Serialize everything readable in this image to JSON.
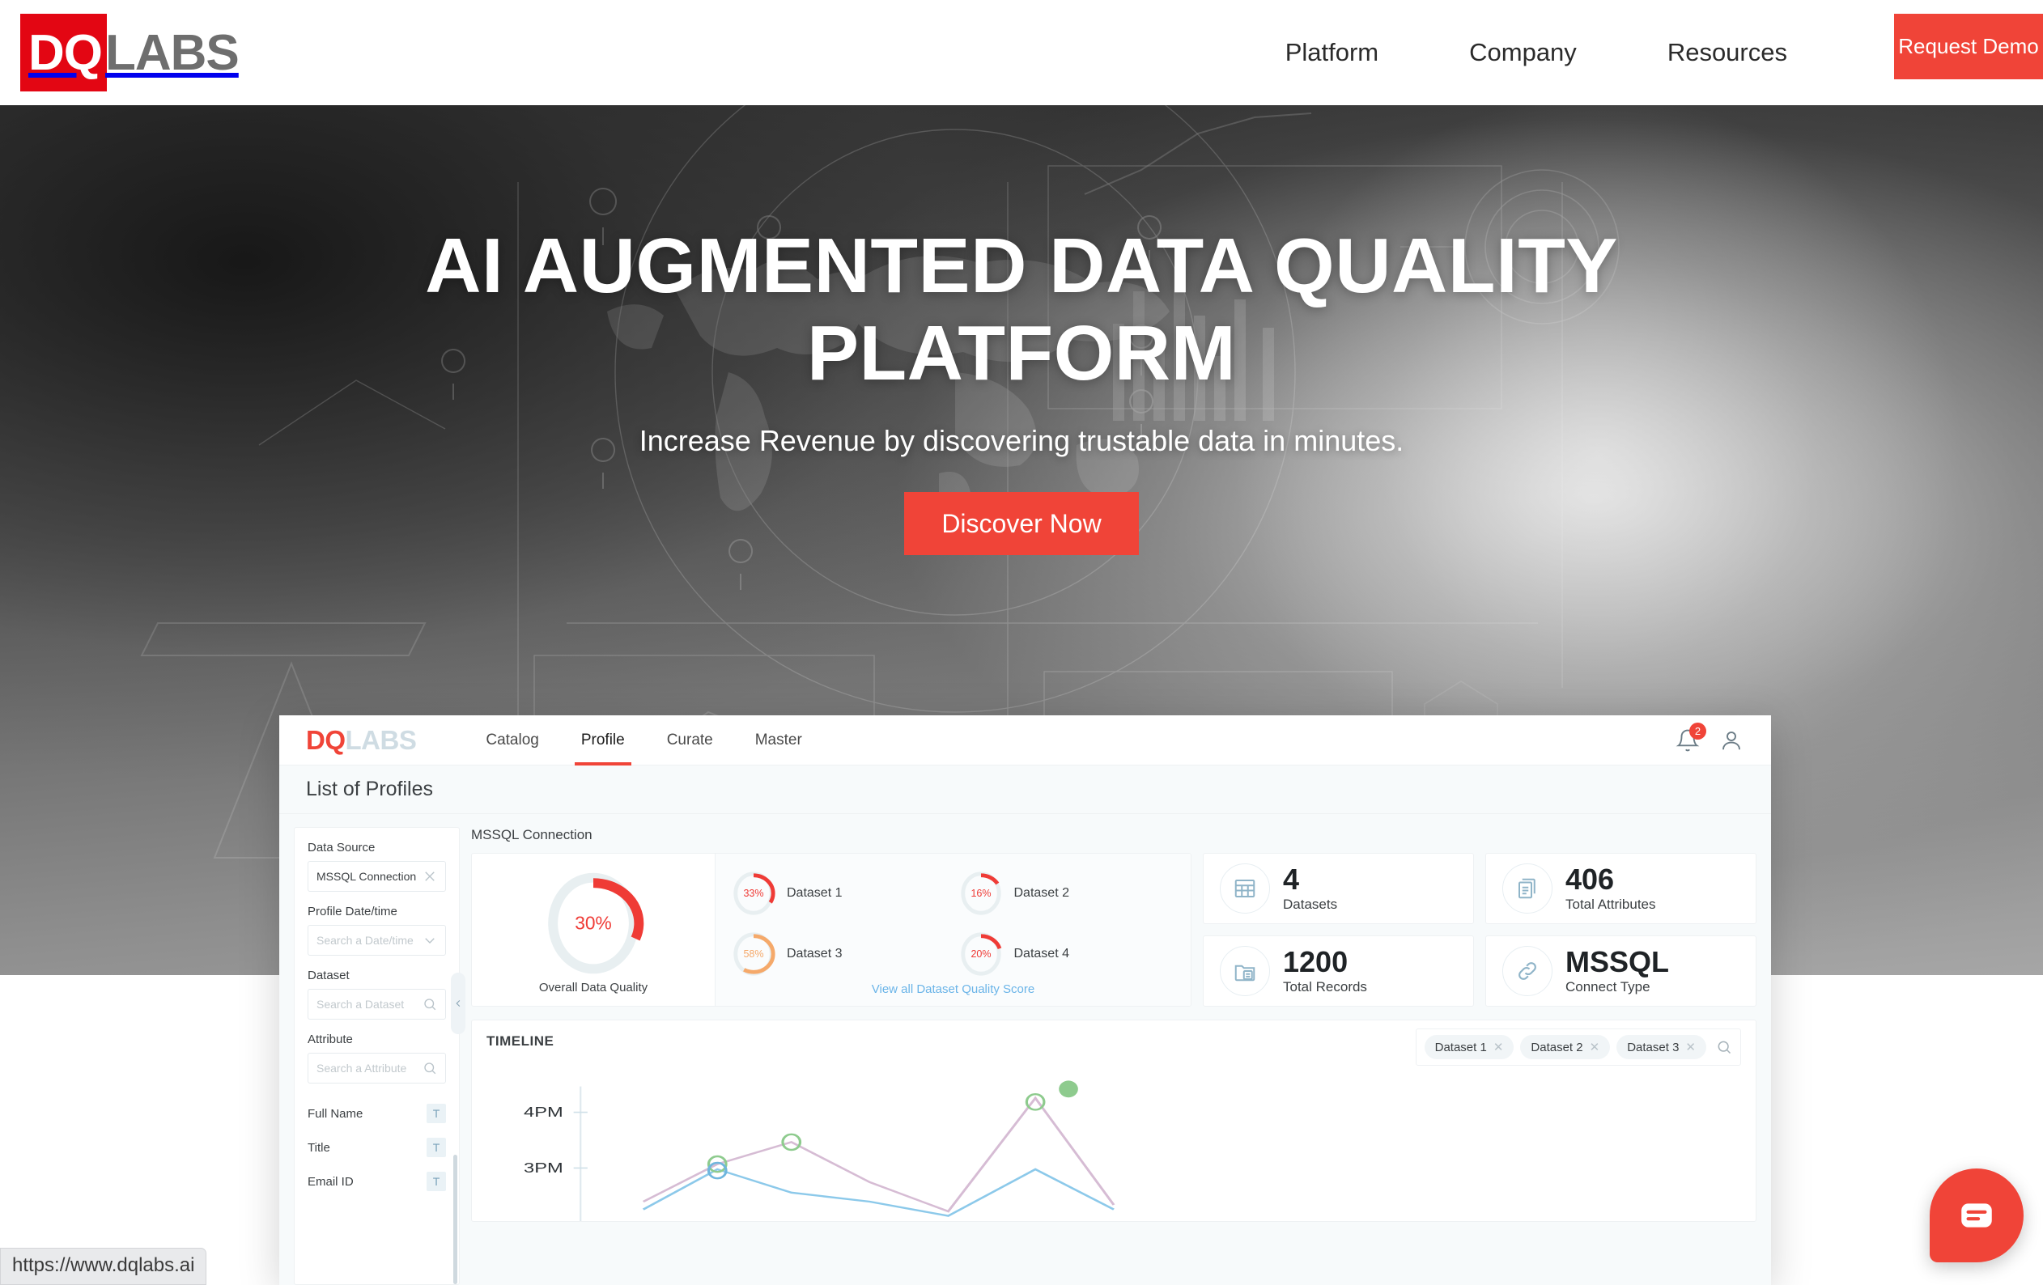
{
  "site": {
    "logo": {
      "mark": "DQ",
      "rest": "LABS"
    },
    "nav": [
      {
        "label": "Platform"
      },
      {
        "label": "Company"
      },
      {
        "label": "Resources"
      }
    ],
    "cta": "Request Demo",
    "accent": "#f04438",
    "brand_red": "#e30613"
  },
  "hero": {
    "title_line1": "AI AUGMENTED DATA QUALITY",
    "title_line2": "PLATFORM",
    "subtitle": "Increase Revenue by discovering trustable data in minutes.",
    "button": "Discover Now"
  },
  "app": {
    "logo": {
      "mark": "DQ",
      "rest": "LABS"
    },
    "tabs": [
      {
        "label": "Catalog",
        "active": false
      },
      {
        "label": "Profile",
        "active": true
      },
      {
        "label": "Curate",
        "active": false
      },
      {
        "label": "Master",
        "active": false
      }
    ],
    "notification_count": "2",
    "page_title": "List of Profiles",
    "sidebar": {
      "fields": [
        {
          "label": "Data Source",
          "value": "MSSQL Connection",
          "placeholder": "",
          "icon": "close-icon"
        },
        {
          "label": "Profile Date/time",
          "value": "",
          "placeholder": "Search a Date/time",
          "icon": "chevron-down-icon"
        },
        {
          "label": "Dataset",
          "value": "",
          "placeholder": "Search a Dataset",
          "icon": "search-icon"
        },
        {
          "label": "Attribute",
          "value": "",
          "placeholder": "Search a Attribute",
          "icon": "search-icon"
        }
      ],
      "attributes": [
        {
          "name": "Full Name",
          "type": "T"
        },
        {
          "name": "Title",
          "type": "T"
        },
        {
          "name": "Email ID",
          "type": "T"
        }
      ]
    },
    "main": {
      "connection_title": "MSSQL Connection",
      "overall": {
        "percent": 30,
        "label_value": "30%",
        "caption": "Overall Data Quality",
        "color": "#ef3b36"
      },
      "datasets": [
        {
          "name": "Dataset 1",
          "label_value": "33%",
          "percent": 33,
          "color": "#ef3b36"
        },
        {
          "name": "Dataset 2",
          "label_value": "16%",
          "percent": 16,
          "color": "#ef3b36"
        },
        {
          "name": "Dataset 3",
          "label_value": "58%",
          "percent": 58,
          "color": "#f5a96a"
        },
        {
          "name": "Dataset 4",
          "label_value": "20%",
          "percent": 20,
          "color": "#ef3b36"
        }
      ],
      "view_all_link": "View all Dataset Quality Score",
      "kpis": [
        {
          "value": "4",
          "caption": "Datasets",
          "icon": "table-grid-icon"
        },
        {
          "value": "406",
          "caption": "Total Attributes",
          "icon": "documents-icon"
        },
        {
          "value": "1200",
          "caption": "Total Records",
          "icon": "records-folder-icon"
        },
        {
          "value": "MSSQL",
          "caption": "Connect Type",
          "icon": "link-icon"
        }
      ],
      "timeline": {
        "title": "TIMELINE",
        "chips": [
          {
            "label": "Dataset 1"
          },
          {
            "label": "Dataset 2"
          },
          {
            "label": "Dataset 3"
          }
        ],
        "y_ticks": [
          "4PM",
          "3PM"
        ]
      }
    }
  },
  "chart_data": {
    "type": "line",
    "title": "TIMELINE",
    "xlabel": "",
    "ylabel": "",
    "y_tick_labels": [
      "3PM",
      "4PM"
    ],
    "series": [
      {
        "name": "Dataset 1",
        "color": "#c9a6c4",
        "x": [
          0,
          1,
          2,
          3,
          4,
          5,
          6
        ],
        "y": [
          1.4,
          2.9,
          3.3,
          2.4,
          1.2,
          4.2,
          2.0
        ]
      },
      {
        "name": "Dataset 2",
        "color": "#7fc6ea",
        "x": [
          0,
          1,
          2,
          3,
          4,
          5,
          6
        ],
        "y": [
          1.1,
          2.9,
          1.9,
          1.5,
          1.0,
          2.4,
          1.4
        ]
      },
      {
        "name": "Dataset 3",
        "color": "#8ecb8e",
        "x": [
          0,
          1,
          2,
          3,
          4,
          5,
          6
        ],
        "y": [
          1.3,
          3.0,
          3.3,
          2.2,
          1.3,
          4.3,
          2.1
        ]
      }
    ],
    "legend": [
      "Dataset 1",
      "Dataset 2",
      "Dataset 3"
    ],
    "grid": false
  },
  "overlays": {
    "status_url": "https://www.dqlabs.ai",
    "chat_icon": "chat-bubble-icon"
  }
}
